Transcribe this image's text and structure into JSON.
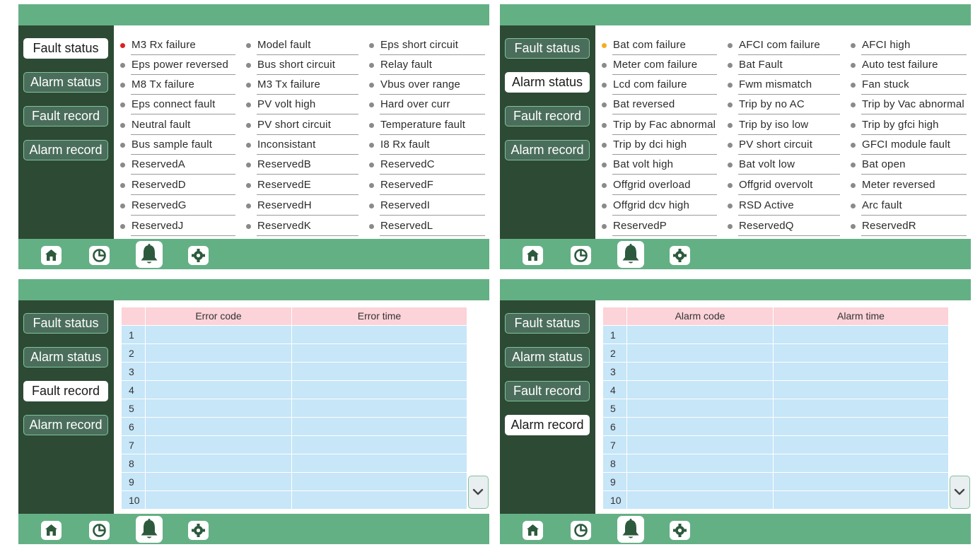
{
  "sidebar_labels": {
    "fault_status": "Fault status",
    "alarm_status": "Alarm status",
    "fault_record": "Fault record",
    "alarm_record": "Alarm record"
  },
  "nav_icons": [
    "home-icon",
    "pie-chart-icon",
    "bell-icon",
    "gear-icon"
  ],
  "colors": {
    "header_green": "#64b085",
    "sidebar_dark": "#2d4a35",
    "table_header_pink": "#fbd3d8",
    "table_row_blue": "#c7e6f8",
    "fault_dot_red": "#e01e1e",
    "alarm_dot_amber": "#f2b01e"
  },
  "fault_status_panel": {
    "active_tab": "fault_status",
    "items": [
      [
        "M3 Rx failure",
        "Model fault",
        "Eps short circuit"
      ],
      [
        "Eps power reversed",
        "Bus short circuit",
        "Relay fault"
      ],
      [
        "M8 Tx failure",
        "M3 Tx failure",
        "Vbus over range"
      ],
      [
        "Eps connect fault",
        "PV volt high",
        "Hard over curr"
      ],
      [
        "Neutral fault",
        "PV short circuit",
        "Temperature fault"
      ],
      [
        "Bus sample fault",
        "Inconsistant",
        "I8 Rx fault"
      ],
      [
        "ReservedA",
        "ReservedB",
        "ReservedC"
      ],
      [
        "ReservedD",
        "ReservedE",
        "ReservedF"
      ],
      [
        "ReservedG",
        "ReservedH",
        "ReservedI"
      ],
      [
        "ReservedJ",
        "ReservedK",
        "ReservedL"
      ]
    ]
  },
  "alarm_status_panel": {
    "active_tab": "alarm_status",
    "items": [
      [
        "Bat com failure",
        "AFCI com failure",
        "AFCI high"
      ],
      [
        "Meter com failure",
        "Bat Fault",
        "Auto test failure"
      ],
      [
        "Lcd com failure",
        "Fwm mismatch",
        "Fan stuck"
      ],
      [
        "Bat reversed",
        "Trip by no AC",
        "Trip by Vac abnormal"
      ],
      [
        "Trip by Fac abnormal",
        "Trip by iso low",
        "Trip by gfci high"
      ],
      [
        "Trip by dci high",
        "PV short circuit",
        "GFCI module fault"
      ],
      [
        "Bat volt high",
        "Bat volt low",
        "Bat open"
      ],
      [
        "Offgrid overload",
        "Offgrid overvolt",
        "Meter reversed"
      ],
      [
        "Offgrid dcv high",
        "RSD Active",
        "Arc fault"
      ],
      [
        "ReservedP",
        "ReservedQ",
        "ReservedR"
      ]
    ]
  },
  "fault_record_panel": {
    "active_tab": "fault_record",
    "columns": [
      "Error code",
      "Error time"
    ],
    "row_numbers": [
      "1",
      "2",
      "3",
      "4",
      "5",
      "6",
      "7",
      "8",
      "9",
      "10"
    ]
  },
  "alarm_record_panel": {
    "active_tab": "alarm_record",
    "columns": [
      "Alarm code",
      "Alarm time"
    ],
    "row_numbers": [
      "1",
      "2",
      "3",
      "4",
      "5",
      "6",
      "7",
      "8",
      "9",
      "10"
    ]
  }
}
